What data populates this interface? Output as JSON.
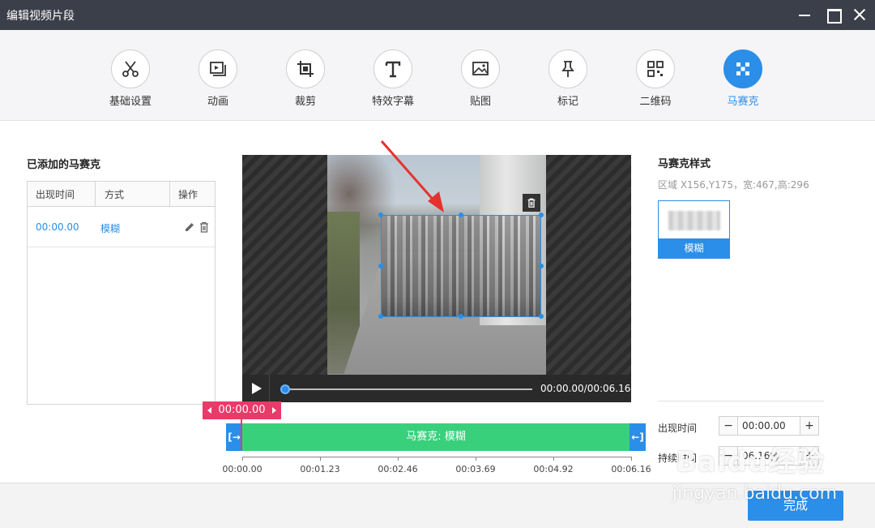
{
  "window": {
    "title": "编辑视频片段"
  },
  "toolbar": {
    "items": [
      {
        "label": "基础设置",
        "icon": "scissors-icon"
      },
      {
        "label": "动画",
        "icon": "play-frame-icon"
      },
      {
        "label": "裁剪",
        "icon": "crop-icon"
      },
      {
        "label": "特效字幕",
        "icon": "text-icon"
      },
      {
        "label": "贴图",
        "icon": "image-icon"
      },
      {
        "label": "标记",
        "icon": "pin-icon"
      },
      {
        "label": "二维码",
        "icon": "qrcode-icon"
      },
      {
        "label": "马赛克",
        "icon": "mosaic-icon",
        "active": true
      }
    ]
  },
  "left_panel": {
    "title": "已添加的马赛克",
    "columns": [
      "出现时间",
      "方式",
      "操作"
    ],
    "rows": [
      {
        "time": "00:00.00",
        "mode": "模糊"
      }
    ]
  },
  "player": {
    "time": "00:00.00/00:06.16",
    "progress": 0
  },
  "right_panel": {
    "title": "马赛克样式",
    "region": "区域 X156,Y175，宽:467,高:296",
    "style_label": "模糊",
    "appear_label": "出现时间",
    "appear_value": "00:00.00",
    "duration_label": "持续时间",
    "duration_value": "06.16",
    "duration_unit": "秒"
  },
  "timeline": {
    "playhead": "00:00.00",
    "clip_label": "马赛克: 模糊",
    "ticks": [
      "00:00.00",
      "00:01.23",
      "00:02.46",
      "00:03.69",
      "00:04.92",
      "00:06.16"
    ]
  },
  "footer": {
    "done_label": "完成"
  },
  "watermark": {
    "logo": "Baidu经验",
    "sub": "jingyan.baidu.com"
  },
  "colors": {
    "accent": "#2b8ee8",
    "clip": "#39d07c",
    "playhead": "#e83b69",
    "titlebar": "#3b3f49"
  }
}
